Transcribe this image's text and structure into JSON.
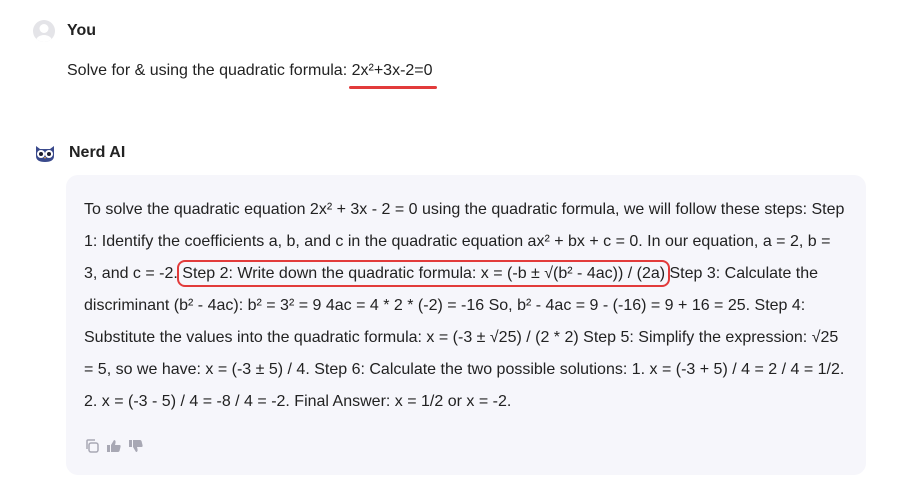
{
  "user": {
    "name": "You",
    "message_prefix": "Solve for & using the quadratic formula: ",
    "equation": "2x²+3x-2=0"
  },
  "ai": {
    "name": "Nerd AI",
    "answer_part1": "To solve the quadratic equation 2x² + 3x - 2 = 0 using the quadratic formula, we will follow these steps: Step 1: Identify the coefficients a, b, and c in the quadratic equation ax² + bx + c = 0. In our equation, a = 2, b = 3, and c = -2. ",
    "answer_highlight": "Step 2: Write down the quadratic formula: x = (-b ± √(b² - 4ac)) / (2a)",
    "answer_part2": " Step 3: Calculate the discriminant (b² - 4ac): b² = 3² = 9 4ac = 4 * 2 * (-2) = -16 So, b² - 4ac = 9 - (-16) = 9 + 16 = 25. Step 4: Substitute the values into the quadratic formula: x = (-3 ± √25) / (2 * 2) Step 5: Simplify the expression: √25 = 5, so we have: x = (-3 ± 5) / 4. Step 6: Calculate the two possible solutions: 1. x = (-3 + 5) / 4 = 2 / 4 = 1/2. 2. x = (-3 - 5) / 4 = -8 / 4 = -2. Final Answer: x = 1/2 or x = -2."
  },
  "actions": {
    "copy_icon": "copy-icon",
    "like_icon": "thumbs-up-icon",
    "dislike_icon": "thumbs-down-icon"
  },
  "colors": {
    "highlight": "#e23b3b",
    "bubble": "#f6f6fb"
  }
}
